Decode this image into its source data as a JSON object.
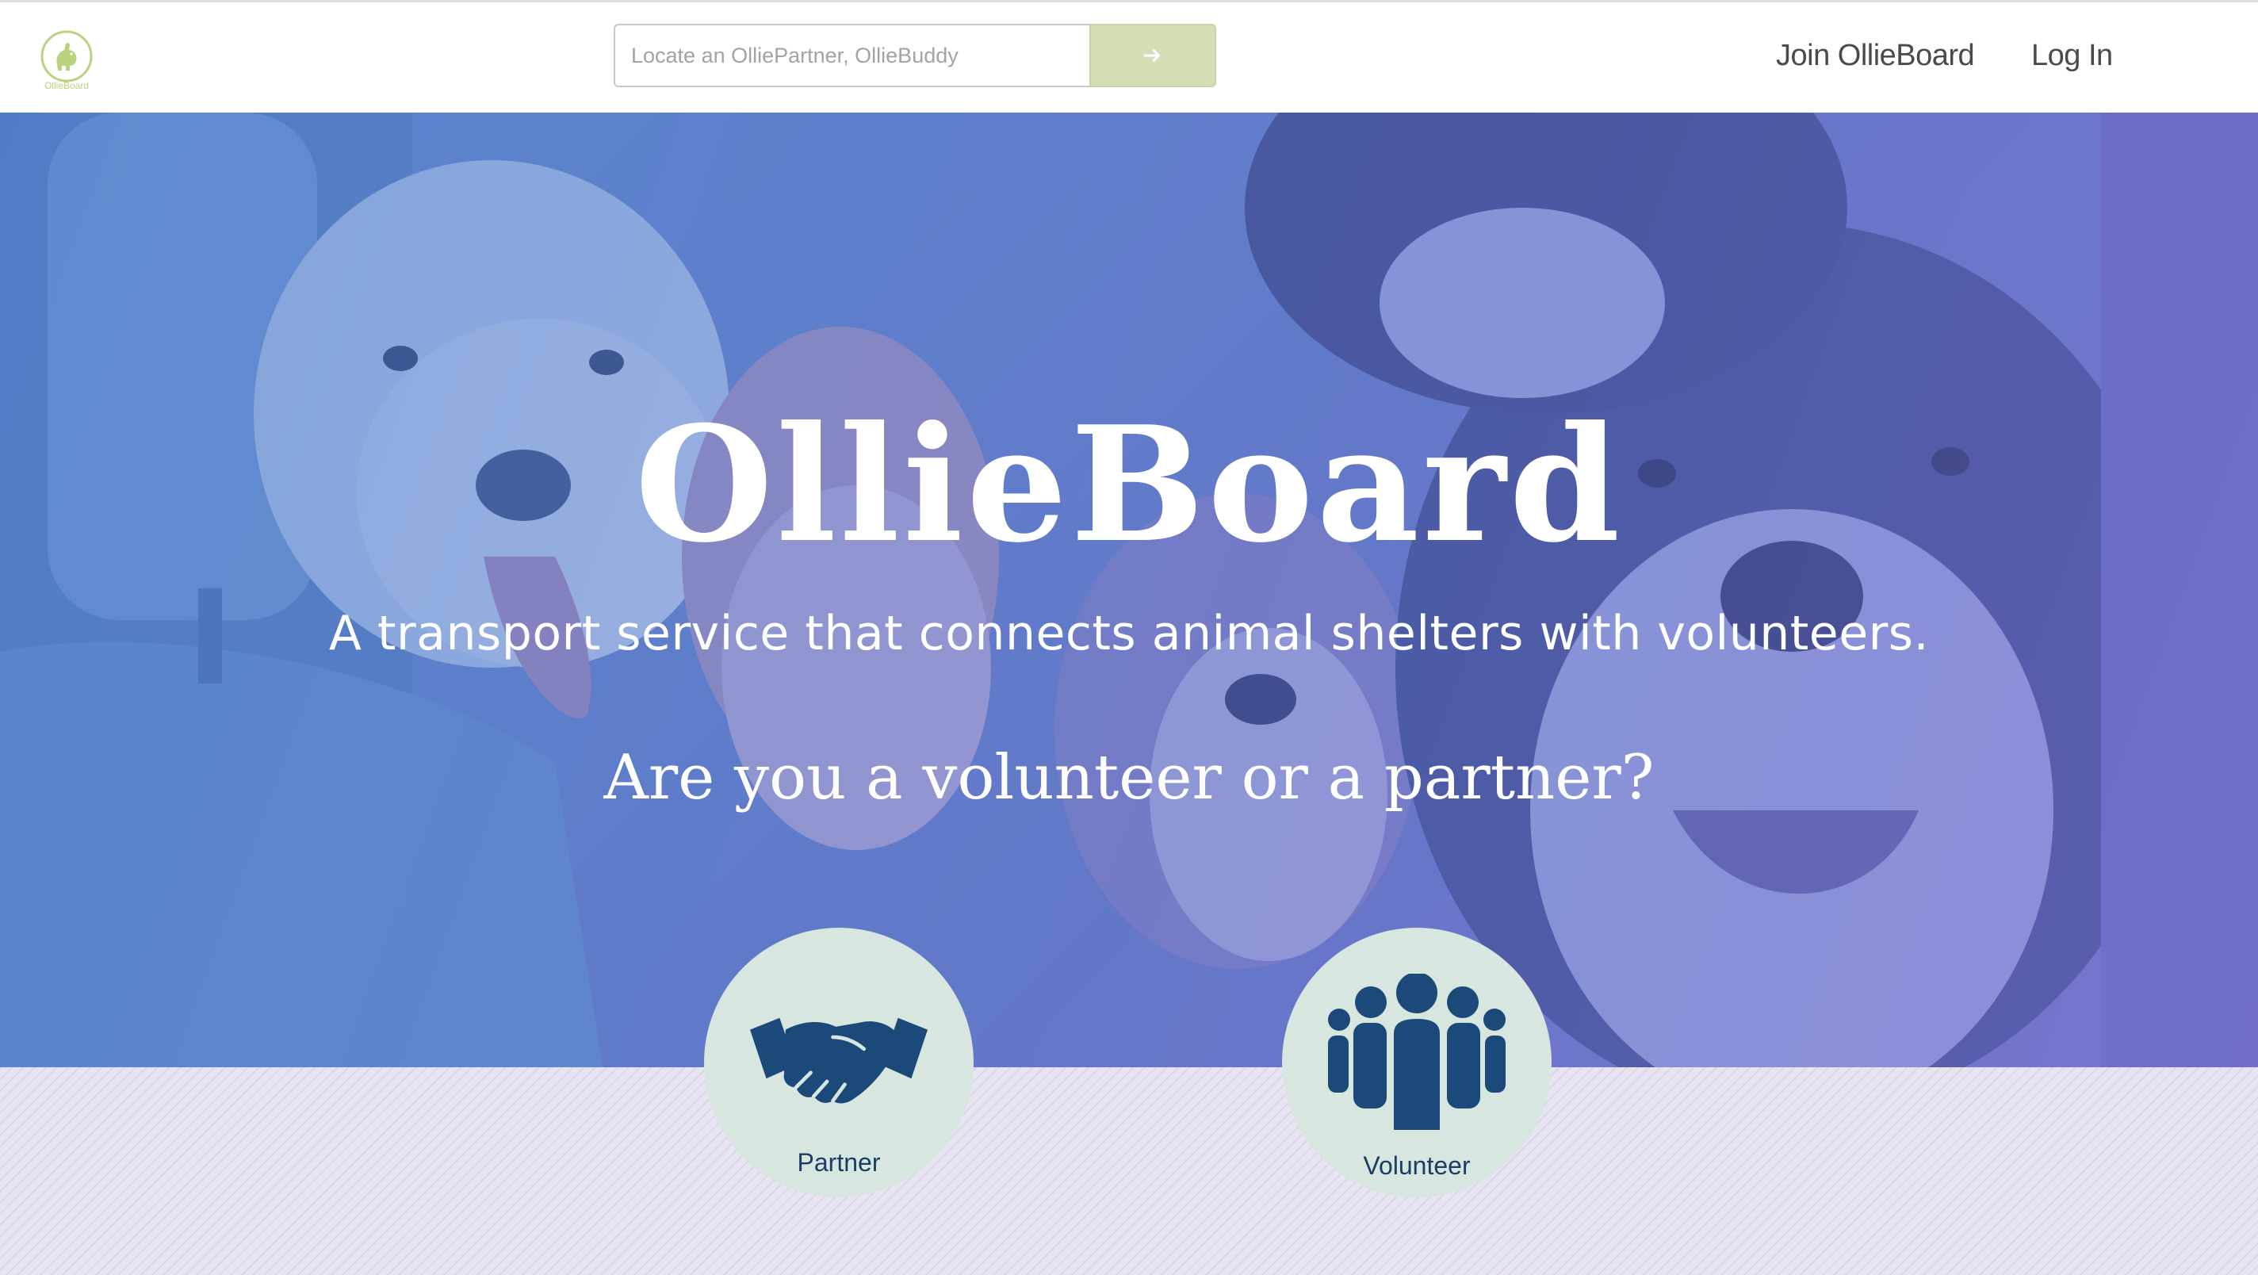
{
  "header": {
    "logo_text": "OllieBoard",
    "search_placeholder": "Locate an OlliePartner, OllieBuddy",
    "search_button_icon": "arrow-right-icon",
    "nav": {
      "join_label": "Join OllieBoard",
      "login_label": "Log In"
    }
  },
  "hero": {
    "title": "OllieBoard",
    "subtitle": "A transport service that connects animal shelters with volunteers.",
    "question": "Are you a volunteer or a partner?"
  },
  "choices": {
    "partner": {
      "label": "Partner",
      "icon": "handshake-icon"
    },
    "volunteer": {
      "label": "Volunteer",
      "icon": "people-group-icon"
    }
  },
  "colors": {
    "brand_green": "#b9d37e",
    "search_button": "#d2dfb5",
    "choice_circle": "#d8e6e0",
    "choice_icon": "#1b4a7a",
    "nav_text": "#4a4a4a"
  }
}
